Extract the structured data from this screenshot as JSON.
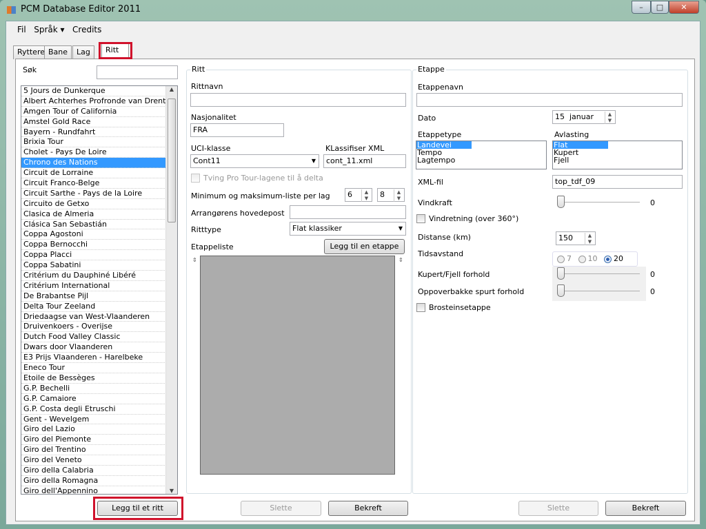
{
  "window": {
    "title": "PCM Database Editor 2011",
    "minimize": "–",
    "maximize": "□",
    "close": "✕"
  },
  "menu": [
    "Fil",
    "Språk ▾",
    "Credits"
  ],
  "tabs": [
    {
      "label": "Ryttere"
    },
    {
      "label": "Bane"
    },
    {
      "label": "Lag"
    },
    {
      "label": "Ritt",
      "active": true
    }
  ],
  "search": {
    "label": "Søk",
    "value": ""
  },
  "races": [
    "5 Jours de Dunkerque",
    "Albert Achterhes Profronde van Drenthe",
    "Amgen Tour of California",
    "Amstel Gold Race",
    "Bayern - Rundfahrt",
    "Brixia Tour",
    "Cholet - Pays De Loire",
    "Chrono des Nations",
    "Circuit de Lorraine",
    "Circuit Franco-Belge",
    "Circuit Sarthe - Pays de la Loire",
    "Circuito de Getxo",
    "Clasica de Almeria",
    "Clásica San Sebastián",
    "Coppa Agostoni",
    "Coppa Bernocchi",
    "Coppa Placci",
    "Coppa Sabatini",
    "Critérium du Dauphiné Libéré",
    "Critérium International",
    "De Brabantse Pijl",
    "Delta Tour Zeeland",
    "Driedaagse van West-Vlaanderen",
    "Druivenkoers - Overijse",
    "Dutch Food Valley Classic",
    "Dwars door Vlaanderen",
    "E3 Prijs Vlaanderen - Harelbeke",
    "Eneco Tour",
    "Etoile de Bessèges",
    "G.P. Bechelli",
    "G.P. Camaiore",
    "G.P. Costa degli Etruschi",
    "Gent - Wevelgem",
    "Giro del Lazio",
    "Giro del Piemonte",
    "Giro del Trentino",
    "Giro del Veneto",
    "Giro della Calabria",
    "Giro della Romagna",
    "Giro dell'Appennino"
  ],
  "selected_race": "Chrono des Nations",
  "add_race_button": "Legg til et ritt",
  "ritt": {
    "group": "Ritt",
    "name_label": "Rittnavn",
    "name_value": "",
    "nation_label": "Nasjonalitet",
    "nation_value": "FRA",
    "uci_label": "UCI-klasse",
    "uci_value": "Cont11",
    "xml_label": "KLassifiser XML",
    "xml_value": "cont_11.xml",
    "force_pro_label": "Tving Pro Tour-lagene til å delta",
    "force_pro_checked": false,
    "minmax_label": "Minimum og maksimum-liste per lag",
    "min_value": "6",
    "max_value": "8",
    "organizer_label": "Arrangørens hovedepost",
    "organizer_value": "",
    "type_label": "Ritttype",
    "type_value": "Flat klassiker",
    "stages_label": "Etappeliste",
    "add_stage_button": "Legg til en etappe",
    "delete_button": "Slette",
    "confirm_button": "Bekreft"
  },
  "etappe": {
    "group": "Etappe",
    "name_label": "Etappenavn",
    "name_value": "",
    "date_label": "Dato",
    "date_day": "15",
    "date_month": "januar",
    "stagetype_label": "Etappetype",
    "stagetypes": [
      "Landevei",
      "Tempo",
      "Lagtempo"
    ],
    "stagetype_selected": "Landevei",
    "relief_label": "Avlasting",
    "reliefs": [
      "Flat",
      "Kupert",
      "Fjell"
    ],
    "relief_selected": "Flat",
    "xml_label": "XML-fil",
    "xml_value": "top_tdf_09",
    "wind_label": "Vindkraft",
    "wind_value": "0",
    "wind_dir_label": "Vindretning (over 360°)",
    "distance_label": "Distanse (km)",
    "distance_value": "150",
    "gap_label": "Tidsavstand",
    "gap_options": [
      "7",
      "10",
      "20"
    ],
    "gap_selected": "20",
    "hilly_label": "Kupert/Fjell forhold",
    "hilly_value": "0",
    "uphill_label": "Oppoverbakke spurt forhold",
    "uphill_value": "0",
    "cobble_label": "Brosteinsetappe",
    "delete_button": "Slette",
    "confirm_button": "Bekreft"
  }
}
